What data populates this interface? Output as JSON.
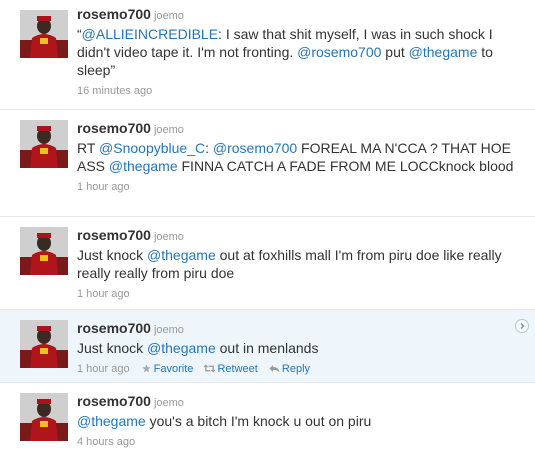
{
  "tweets": [
    {
      "screen_name": "rosemo700",
      "full_name": "joemo",
      "segments": [
        {
          "t": "“",
          "link": false
        },
        {
          "t": "@ALLIEINCREDIBLE",
          "link": true
        },
        {
          "t": ": I saw that shit myself, I was in such shock I didn't video tape it. I'm not fronting. ",
          "link": false
        },
        {
          "t": "@rosemo700",
          "link": true
        },
        {
          "t": " put ",
          "link": false
        },
        {
          "t": "@thegame",
          "link": true
        },
        {
          "t": " to sleep”",
          "link": false
        }
      ],
      "timestamp": "16 minutes ago"
    },
    {
      "screen_name": "rosemo700",
      "full_name": "joemo",
      "segments": [
        {
          "t": "RT ",
          "link": false
        },
        {
          "t": "@Snoopyblue_C",
          "link": true
        },
        {
          "t": ": ",
          "link": false
        },
        {
          "t": "@rosemo700",
          "link": true
        },
        {
          "t": " FOREAL MA N'CCA ? THAT HOE ASS ",
          "link": false
        },
        {
          "t": "@thegame",
          "link": true
        },
        {
          "t": " FINNA CATCH A FADE FROM ME LOCCknock blood",
          "link": false
        }
      ],
      "timestamp": "1 hour ago"
    },
    {
      "screen_name": "rosemo700",
      "full_name": "joemo",
      "segments": [
        {
          "t": "Just knock ",
          "link": false
        },
        {
          "t": "@thegame",
          "link": true
        },
        {
          "t": " out at foxhills mall I'm from piru doe like really really really from piru doe",
          "link": false
        }
      ],
      "timestamp": "1 hour ago"
    },
    {
      "screen_name": "rosemo700",
      "full_name": "joemo",
      "segments": [
        {
          "t": "Just knock ",
          "link": false
        },
        {
          "t": "@thegame",
          "link": true
        },
        {
          "t": " out in menlands",
          "link": false
        }
      ],
      "timestamp": "1 hour ago",
      "actions": {
        "favorite": "Favorite",
        "retweet": "Retweet",
        "reply": "Reply"
      }
    },
    {
      "screen_name": "rosemo700",
      "full_name": "joemo",
      "segments": [
        {
          "t": "@thegame",
          "link": true
        },
        {
          "t": " you's a bitch I'm knock u out on piru",
          "link": false
        }
      ],
      "timestamp": "4 hours ago"
    }
  ],
  "colors": {
    "link": "#2276bb",
    "hover_bg": "#eef6fb",
    "meta": "#999999"
  }
}
